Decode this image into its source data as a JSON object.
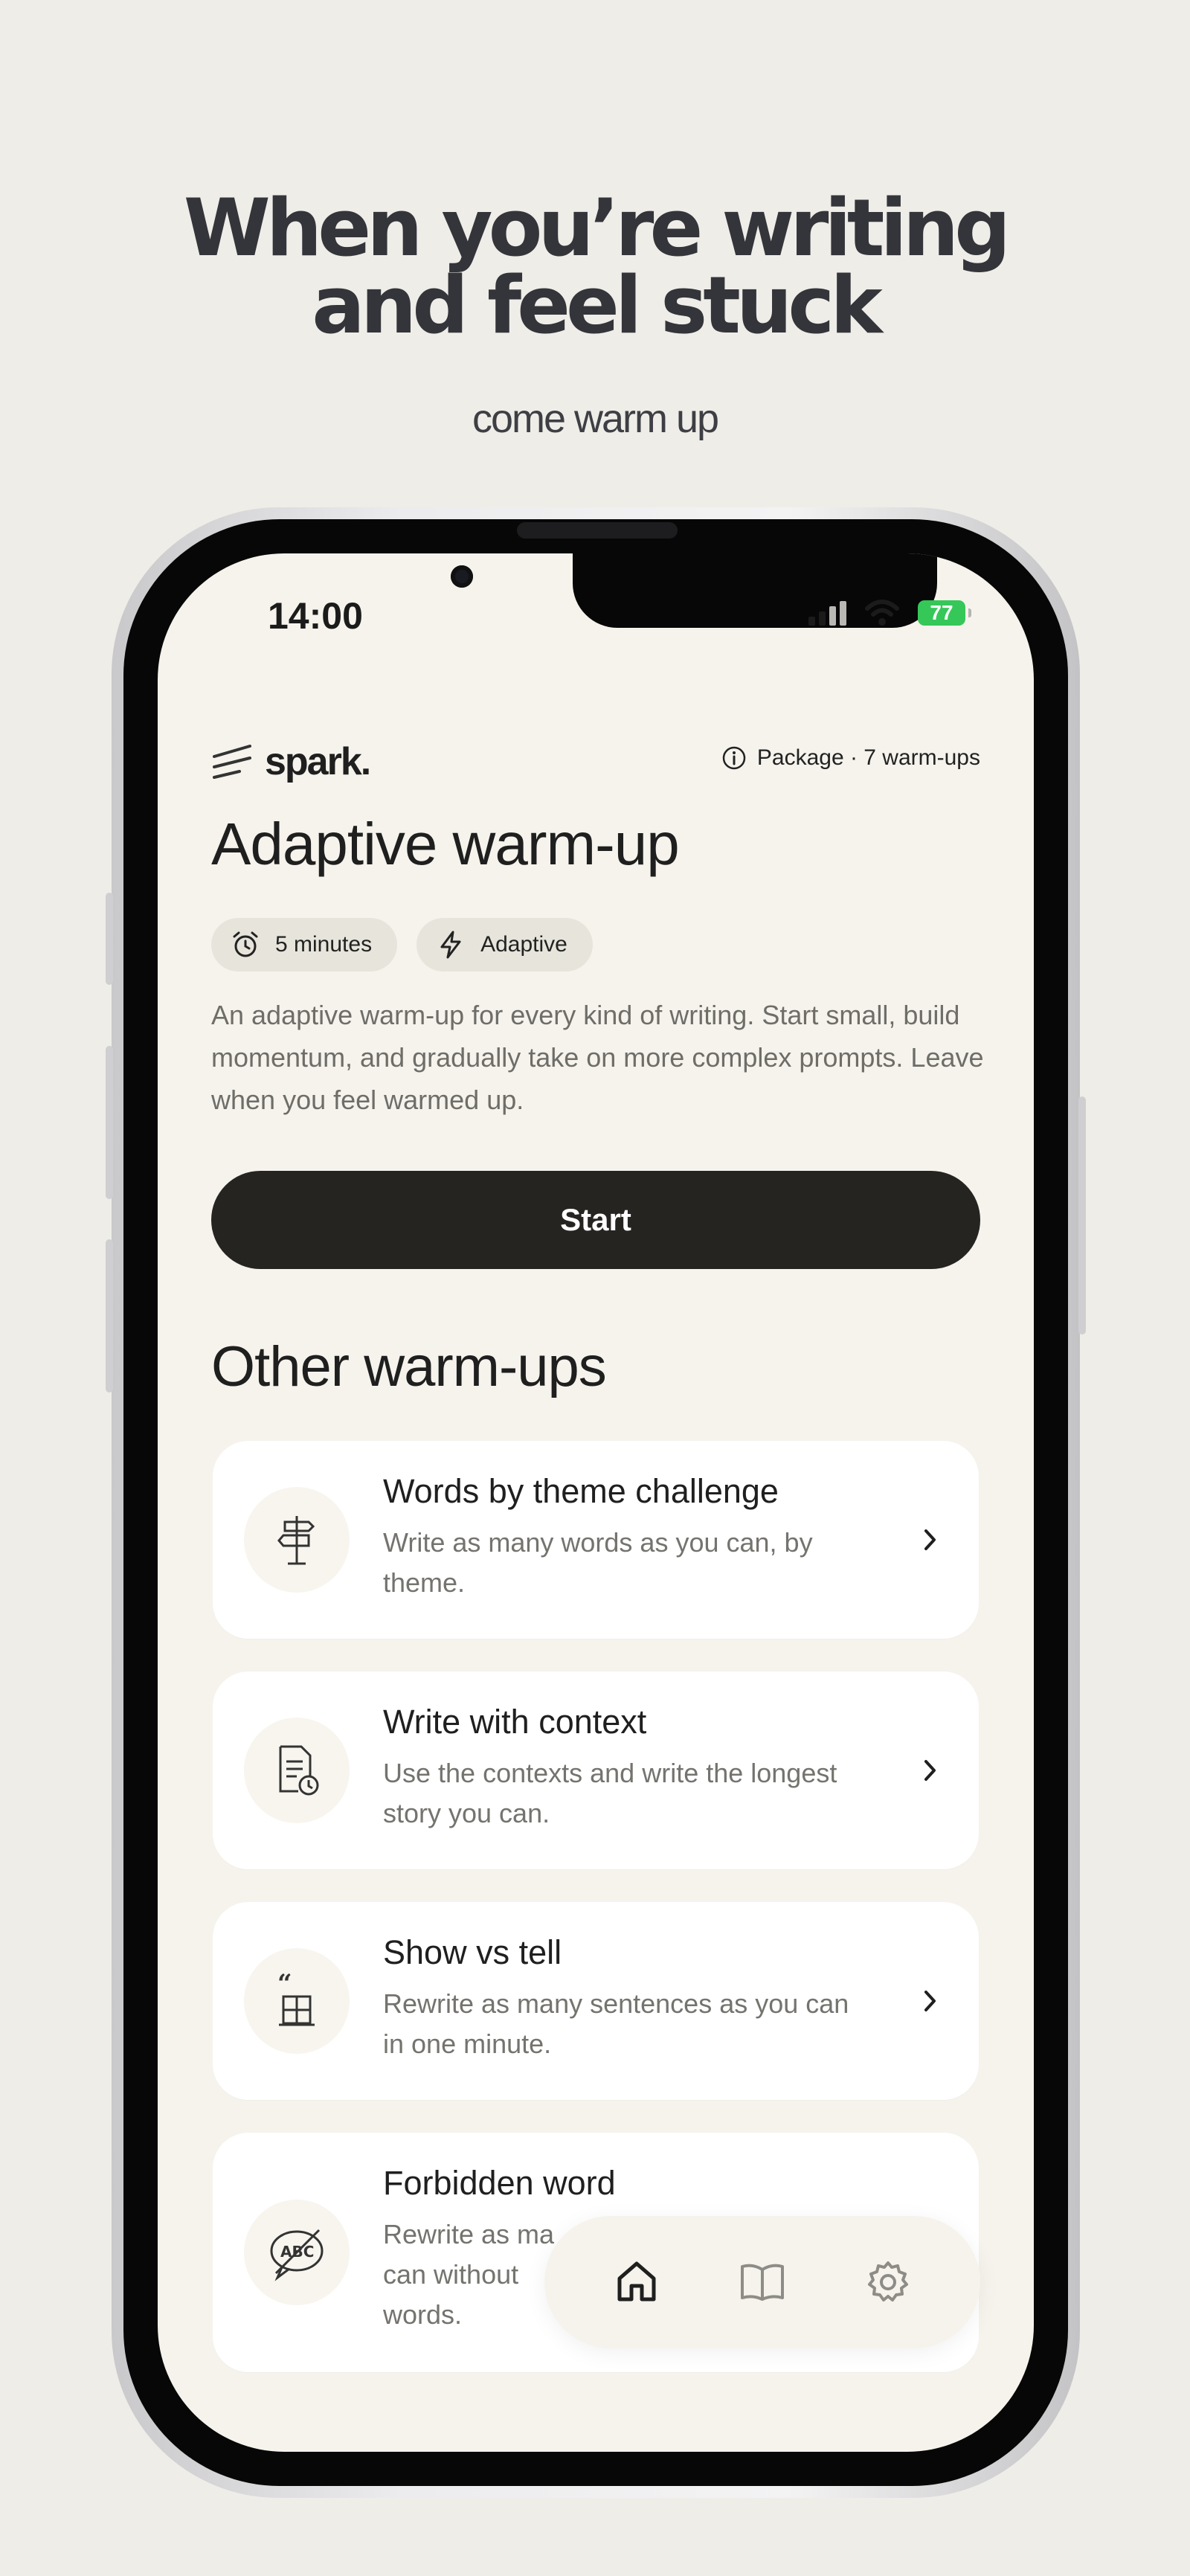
{
  "hero": {
    "headline_line1": "When you’re writing",
    "headline_line2": "and feel stuck",
    "subheadline": "come warm up"
  },
  "status_bar": {
    "time": "14:00",
    "battery": "77"
  },
  "header": {
    "brand": "spark.",
    "package_label": "Package · 7 warm-ups"
  },
  "warmup": {
    "title": "Adaptive warm-up",
    "chips": [
      {
        "label": "5 minutes",
        "icon": "alarm-clock-icon"
      },
      {
        "label": "Adaptive",
        "icon": "lightning-bolt-icon"
      }
    ],
    "description": "An adaptive warm-up for every kind of writing. Start small, build momentum, and gradually take on more complex prompts. Leave when you feel warmed up.",
    "start_label": "Start"
  },
  "other": {
    "section_title": "Other warm-ups",
    "items": [
      {
        "title": "Words by theme challenge",
        "description": "Write as many words as you can, by theme.",
        "icon": "signpost-icon"
      },
      {
        "title": "Write with context",
        "description": "Use the contexts and write the longest story you can.",
        "icon": "document-clock-icon"
      },
      {
        "title": "Show vs tell",
        "description": "Rewrite as many sentences as you can in one minute.",
        "icon": "quote-window-icon"
      },
      {
        "title": "Forbidden word",
        "description": "Rewrite as ma",
        "description_line2": "can without",
        "description_line3": "words.",
        "icon": "no-abc-icon"
      }
    ]
  },
  "tabbar": {
    "tabs": [
      {
        "name": "home",
        "icon": "home-icon",
        "active": true
      },
      {
        "name": "library",
        "icon": "book-icon",
        "active": false
      },
      {
        "name": "settings",
        "icon": "gear-icon",
        "active": false
      }
    ]
  },
  "colors": {
    "page_background": "#efede8",
    "screen_background": "#f5f3ec",
    "button_dark": "#252420",
    "chip_background": "#e7e4db",
    "battery_green": "#36c759"
  }
}
